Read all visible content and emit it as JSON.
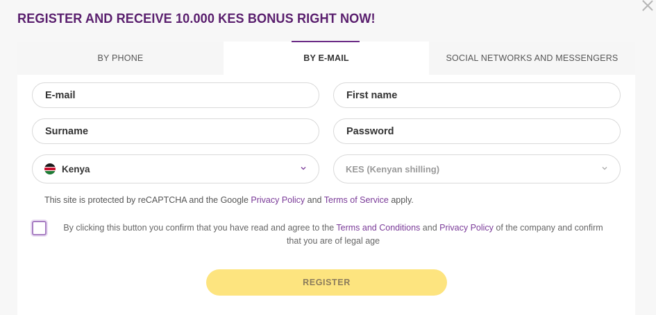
{
  "title": "REGISTER AND RECEIVE 10.000 KES BONUS RIGHT NOW!",
  "tabs": [
    {
      "label": "BY PHONE",
      "active": false
    },
    {
      "label": "BY E-MAIL",
      "active": true
    },
    {
      "label": "SOCIAL NETWORKS AND MESSENGERS",
      "active": false
    }
  ],
  "form": {
    "email_placeholder": "E-mail",
    "first_name_placeholder": "First name",
    "surname_placeholder": "Surname",
    "password_placeholder": "Password",
    "country": "Kenya",
    "currency": "KES (Kenyan shilling)"
  },
  "recaptcha": {
    "prefix": "This site is protected by reCAPTCHA and the Google ",
    "privacy_link": "Privacy Policy",
    "and": " and ",
    "terms_link": "Terms of Service",
    "suffix": " apply."
  },
  "consent": {
    "prefix": "By clicking this button you confirm that you have read and agree to the ",
    "terms_link": "Terms and Conditions",
    "and": " and ",
    "privacy_link": "Privacy Policy",
    "suffix": " of the company and confirm that you are of legal age",
    "checked": false
  },
  "register_label": "REGISTER",
  "colors": {
    "title": "#5a1f6e",
    "accent": "#6b2b86",
    "link": "#7a3a98",
    "button": "#fde47f"
  }
}
